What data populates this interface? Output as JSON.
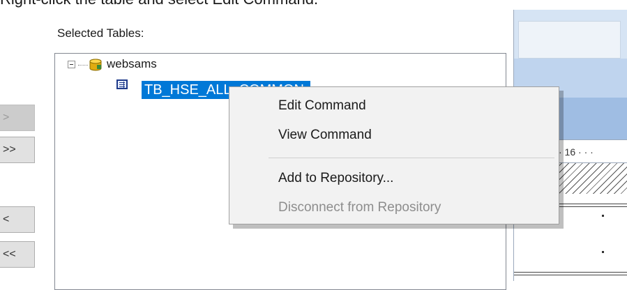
{
  "instruction": "Right-click the table and select Edit Command.",
  "panel": {
    "title": "Selected Tables:",
    "tree": {
      "database": {
        "label": "websams",
        "icon": "database-icon",
        "expander": "collapse-icon"
      },
      "table": {
        "label": "TB_HSE_ALL_COMMON",
        "icon": "table-icon",
        "selected": true
      }
    }
  },
  "side_buttons": [
    {
      "label": ">",
      "enabled": false
    },
    {
      "label": ">>",
      "enabled": true
    },
    {
      "label": "<",
      "enabled": true
    },
    {
      "label": "<<",
      "enabled": true
    }
  ],
  "context_menu": {
    "items": [
      {
        "label": "Edit Command",
        "enabled": true
      },
      {
        "label": "View Command",
        "enabled": true
      },
      {
        "label": "Add to Repository...",
        "enabled": true
      },
      {
        "label": "Disconnect from Repository",
        "enabled": false
      }
    ]
  },
  "right_panel": {
    "ruler_text": "· 16 ·  ·  ·"
  },
  "colors": {
    "selection": "#0078d7",
    "menu_background": "#f2f2f2",
    "disabled_text": "#8d8d8d"
  }
}
